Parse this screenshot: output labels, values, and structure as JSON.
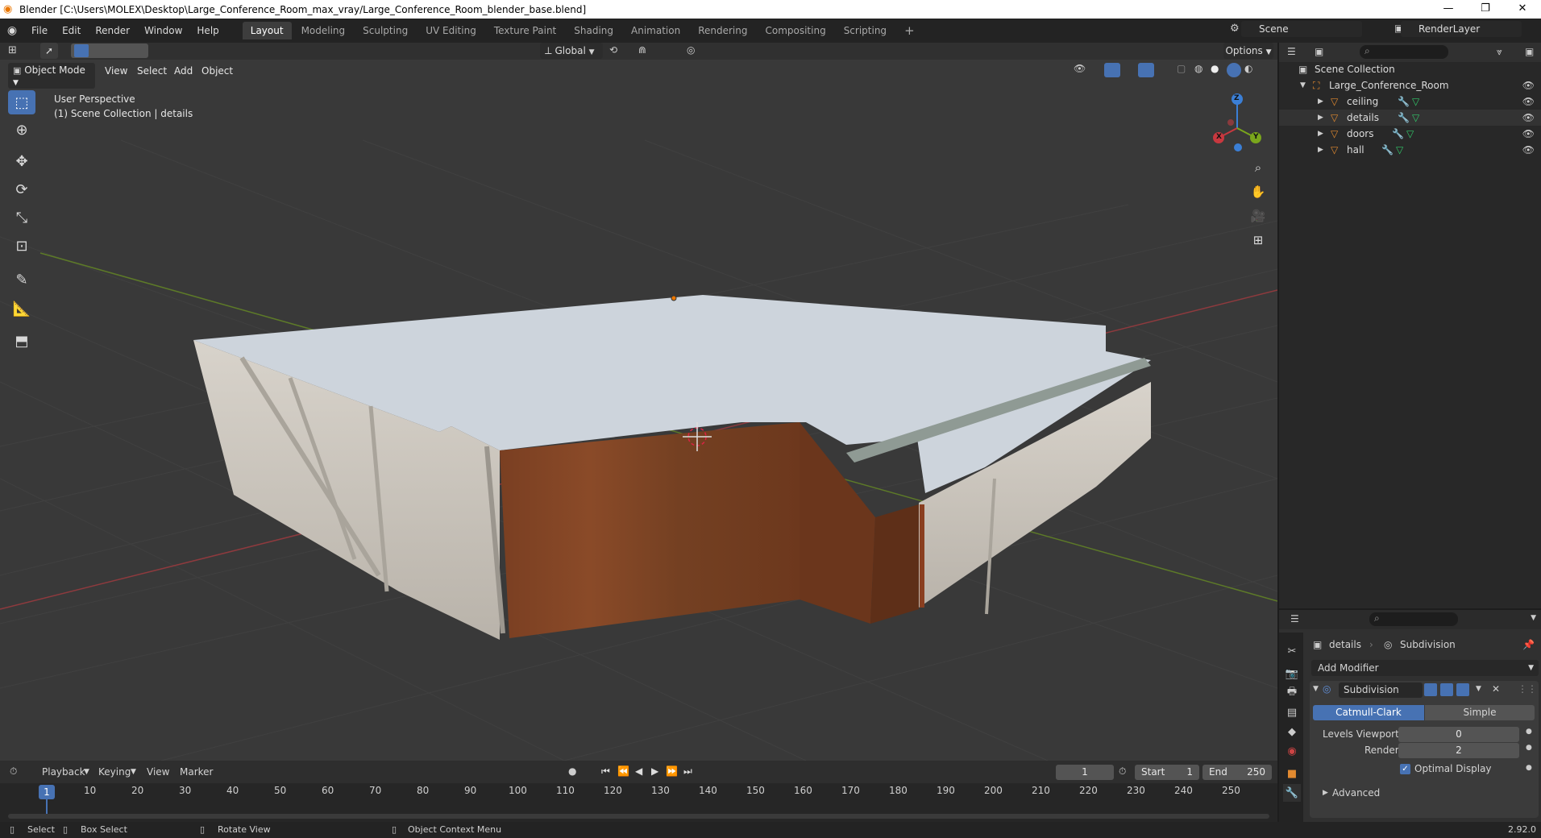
{
  "window": {
    "title": "Blender [C:\\Users\\MOLEX\\Desktop\\Large_Conference_Room_max_vray/Large_Conference_Room_blender_base.blend]",
    "minimize": "—",
    "maximize": "❐",
    "close": "✕"
  },
  "menu": [
    "File",
    "Edit",
    "Render",
    "Window",
    "Help"
  ],
  "workspaces": [
    "Layout",
    "Modeling",
    "Sculpting",
    "UV Editing",
    "Texture Paint",
    "Shading",
    "Animation",
    "Rendering",
    "Compositing",
    "Scripting"
  ],
  "workspace_add": "+",
  "scene": {
    "scene_name": "Scene",
    "render_layer": "RenderLayer"
  },
  "viewport_header": {
    "transform_orientation": "Global",
    "options": "Options",
    "mode": "Object Mode",
    "view": "View",
    "select": "Select",
    "add": "Add",
    "object": "Object"
  },
  "viewport": {
    "perspective": "User Perspective",
    "collection_info": "(1) Scene Collection | details",
    "gizmo_x": "X",
    "gizmo_y": "Y",
    "gizmo_z": "Z"
  },
  "outliner": {
    "root": "Scene Collection",
    "collection": "Large_Conference_Room",
    "objects": [
      "ceiling",
      "details",
      "doors",
      "hall"
    ]
  },
  "properties": {
    "object_name": "details",
    "modifier_breadcrumb": "Subdivision",
    "add_modifier": "Add Modifier",
    "modifier_name": "Subdivision",
    "catmull_clark": "Catmull-Clark",
    "simple": "Simple",
    "levels_viewport_label": "Levels Viewport",
    "levels_viewport_value": "0",
    "render_label": "Render",
    "render_value": "2",
    "optimal_display": "Optimal Display",
    "advanced": "Advanced"
  },
  "timeline": {
    "playback": "Playback",
    "keying": "Keying",
    "view": "View",
    "marker": "Marker",
    "current_frame": "1",
    "start_label": "Start",
    "start_value": "1",
    "end_label": "End",
    "end_value": "250",
    "ticks": [
      "10",
      "20",
      "30",
      "40",
      "50",
      "60",
      "70",
      "80",
      "90",
      "100",
      "110",
      "120",
      "130",
      "140",
      "150",
      "160",
      "170",
      "180",
      "190",
      "200",
      "210",
      "220",
      "230",
      "240",
      "250"
    ],
    "playhead": "1"
  },
  "statusbar": {
    "select": "Select",
    "box_select": "Box Select",
    "rotate_view": "Rotate View",
    "context_menu": "Object Context Menu",
    "version": "2.92.0"
  },
  "colors": {
    "accent": "#4772b3",
    "blender_orange": "#ea7600",
    "x_axis": "#c8383f",
    "y_axis": "#7aa61c",
    "z_axis": "#3b7fd6"
  }
}
